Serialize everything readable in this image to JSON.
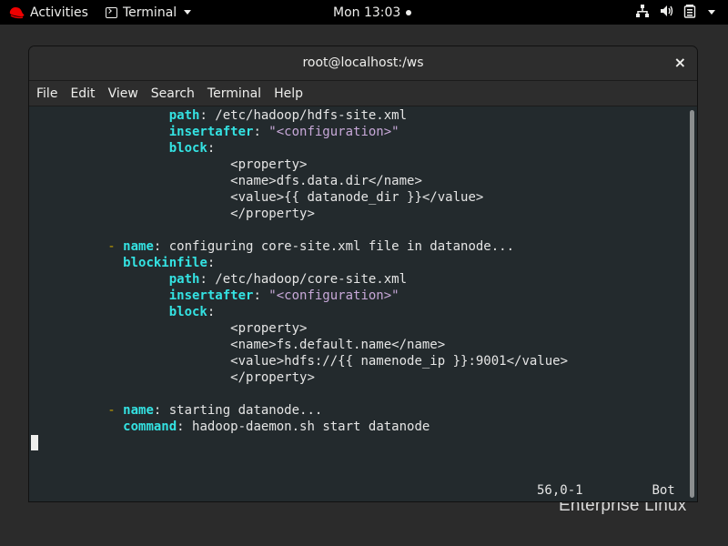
{
  "topbar": {
    "activities": "Activities",
    "app_name": "Terminal",
    "clock": "Mon 13:03",
    "icons": [
      "redhat-logo-icon",
      "terminal-app-icon",
      "network-icon",
      "volume-icon",
      "battery-icon",
      "system-menu-caret-icon"
    ]
  },
  "desktop": {
    "watermark": "Enterprise Linux"
  },
  "window": {
    "title": "root@localhost:/ws",
    "close": "×",
    "menu": [
      "File",
      "Edit",
      "View",
      "Search",
      "Terminal",
      "Help"
    ]
  },
  "editor": {
    "lines": [
      {
        "indent": "                  ",
        "key": "path",
        "colon": ": ",
        "value": "/etc/hadoop/hdfs-site.xml"
      },
      {
        "indent": "                  ",
        "key": "insertafter",
        "colon": ": ",
        "string": "\"<configuration>\""
      },
      {
        "indent": "                  ",
        "key": "block",
        "colon": ":"
      },
      {
        "indent": "                          ",
        "text": "<property>"
      },
      {
        "indent": "                          ",
        "text": "<name>dfs.data.dir</name>"
      },
      {
        "indent": "                          ",
        "text": "<value>{{ datanode_dir }}</value>"
      },
      {
        "indent": "                          ",
        "text": "</property>"
      },
      {
        "indent": "",
        "text": ""
      },
      {
        "indent": "          ",
        "dash": "- ",
        "key": "name",
        "colon": ": ",
        "value": "configuring core-site.xml file in datanode..."
      },
      {
        "indent": "            ",
        "key": "blockinfile",
        "colon": ":"
      },
      {
        "indent": "                  ",
        "key": "path",
        "colon": ": ",
        "value": "/etc/hadoop/core-site.xml"
      },
      {
        "indent": "                  ",
        "key": "insertafter",
        "colon": ": ",
        "string": "\"<configuration>\""
      },
      {
        "indent": "                  ",
        "key": "block",
        "colon": ":"
      },
      {
        "indent": "                          ",
        "text": "<property>"
      },
      {
        "indent": "                          ",
        "text": "<name>fs.default.name</name>"
      },
      {
        "indent": "                          ",
        "text": "<value>hdfs://{{ namenode_ip }}:9001</value>"
      },
      {
        "indent": "                          ",
        "text": "</property>"
      },
      {
        "indent": "",
        "text": ""
      },
      {
        "indent": "          ",
        "dash": "- ",
        "key": "name",
        "colon": ": ",
        "value": "starting datanode..."
      },
      {
        "indent": "            ",
        "key": "command",
        "colon": ": ",
        "value": "hadoop-daemon.sh start datanode"
      }
    ],
    "status_position": "56,0-1",
    "status_scroll": "Bot"
  }
}
